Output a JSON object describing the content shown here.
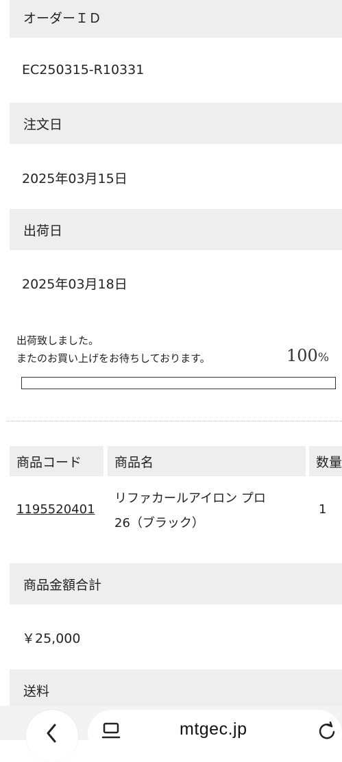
{
  "order_id": {
    "label": "オーダーＩＤ",
    "value": "EC250315-R10331"
  },
  "order_date": {
    "label": "注文日",
    "value": "2025年03月15日"
  },
  "ship_date": {
    "label": "出荷日",
    "value": "2025年03月18日"
  },
  "shipment_status": {
    "line1": "出荷致しました。",
    "line2": "またのお買い上げをお待ちしております。",
    "progress_number": "100",
    "progress_unit": "%",
    "progress_fraction": 1.0
  },
  "items_table": {
    "headers": [
      "商品コード",
      "商品名",
      "数量"
    ],
    "rows": [
      {
        "code": "1195520401",
        "name_line1": "リファカールアイロン プロ",
        "name_line2": "26（ブラック）",
        "qty": "1"
      }
    ]
  },
  "subtotal": {
    "label": "商品金額合計",
    "value": "￥25,000"
  },
  "shipping": {
    "label": "送料"
  },
  "browser": {
    "url": "mtgec.jp"
  }
}
